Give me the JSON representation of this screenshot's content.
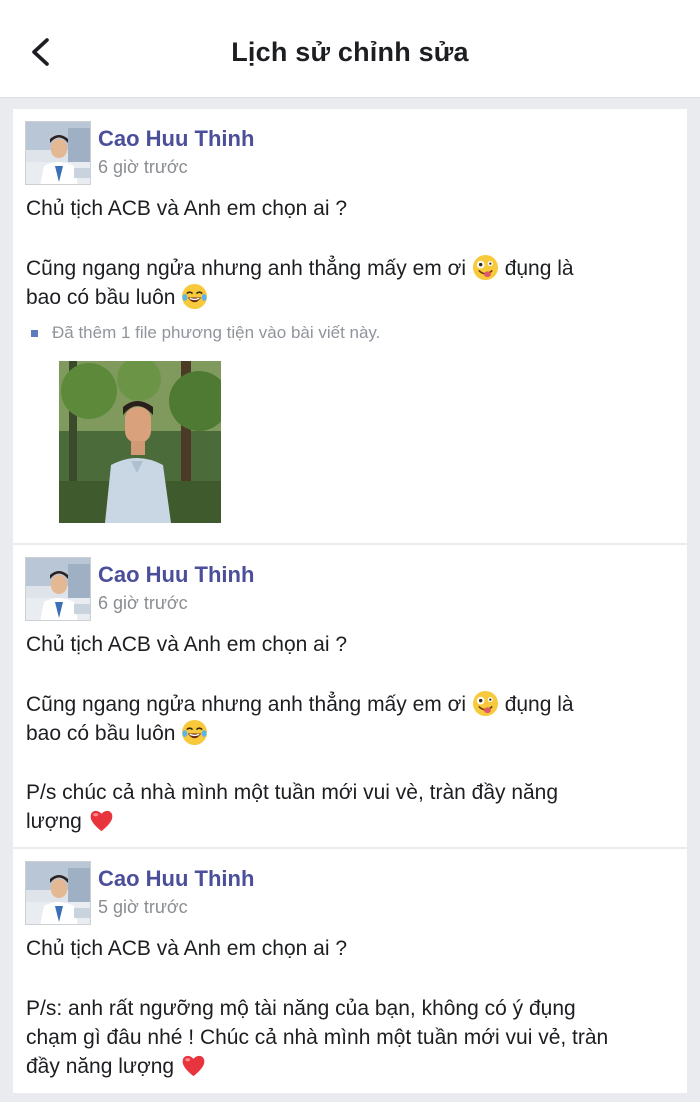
{
  "header": {
    "title": "Lịch sử chỉnh sửa",
    "back_icon": "chevron-left-icon"
  },
  "revisions": [
    {
      "author": "Cao Huu Thinh",
      "time": "6 giờ trước",
      "lines": [
        "Chủ tịch ACB và Anh em chọn ai ?",
        "Cũng ngang ngửa nhưng anh thẳng mấy em ơi",
        "đụng là",
        "bao có bầu luôn"
      ],
      "media_note": "Đã thêm 1 file phương tiện vào bài viết này."
    },
    {
      "author": "Cao Huu Thinh",
      "time": "6 giờ trước",
      "lines": [
        "Chủ tịch ACB và Anh em chọn ai ?",
        "Cũng ngang ngửa nhưng anh thẳng mấy em ơi",
        "đụng là",
        "bao có bầu luôn",
        "P/s chúc cả nhà mình một tuần mới vui vè, tràn đầy năng",
        "lượng"
      ]
    },
    {
      "author": "Cao Huu Thinh",
      "time": "5 giờ trước",
      "lines": [
        "Chủ tịch ACB và Anh em chọn ai ?",
        "P/s: anh rất ngưỡng mộ tài năng của bạn, không có ý đụng",
        "chạm gì đâu nhé ! Chúc cả nhà mình một tuần mới vui vẻ, tràn",
        "đầy năng lượng"
      ]
    }
  ],
  "icons": {
    "zany": "zany-face-emoji",
    "laugh": "tears-of-joy-emoji",
    "heart": "red-heart-emoji",
    "media_bullet": "square-bullet-icon"
  },
  "colors": {
    "author": "#4b5d8f",
    "timestamp": "#8a8d91",
    "background": "#e9ebee"
  }
}
